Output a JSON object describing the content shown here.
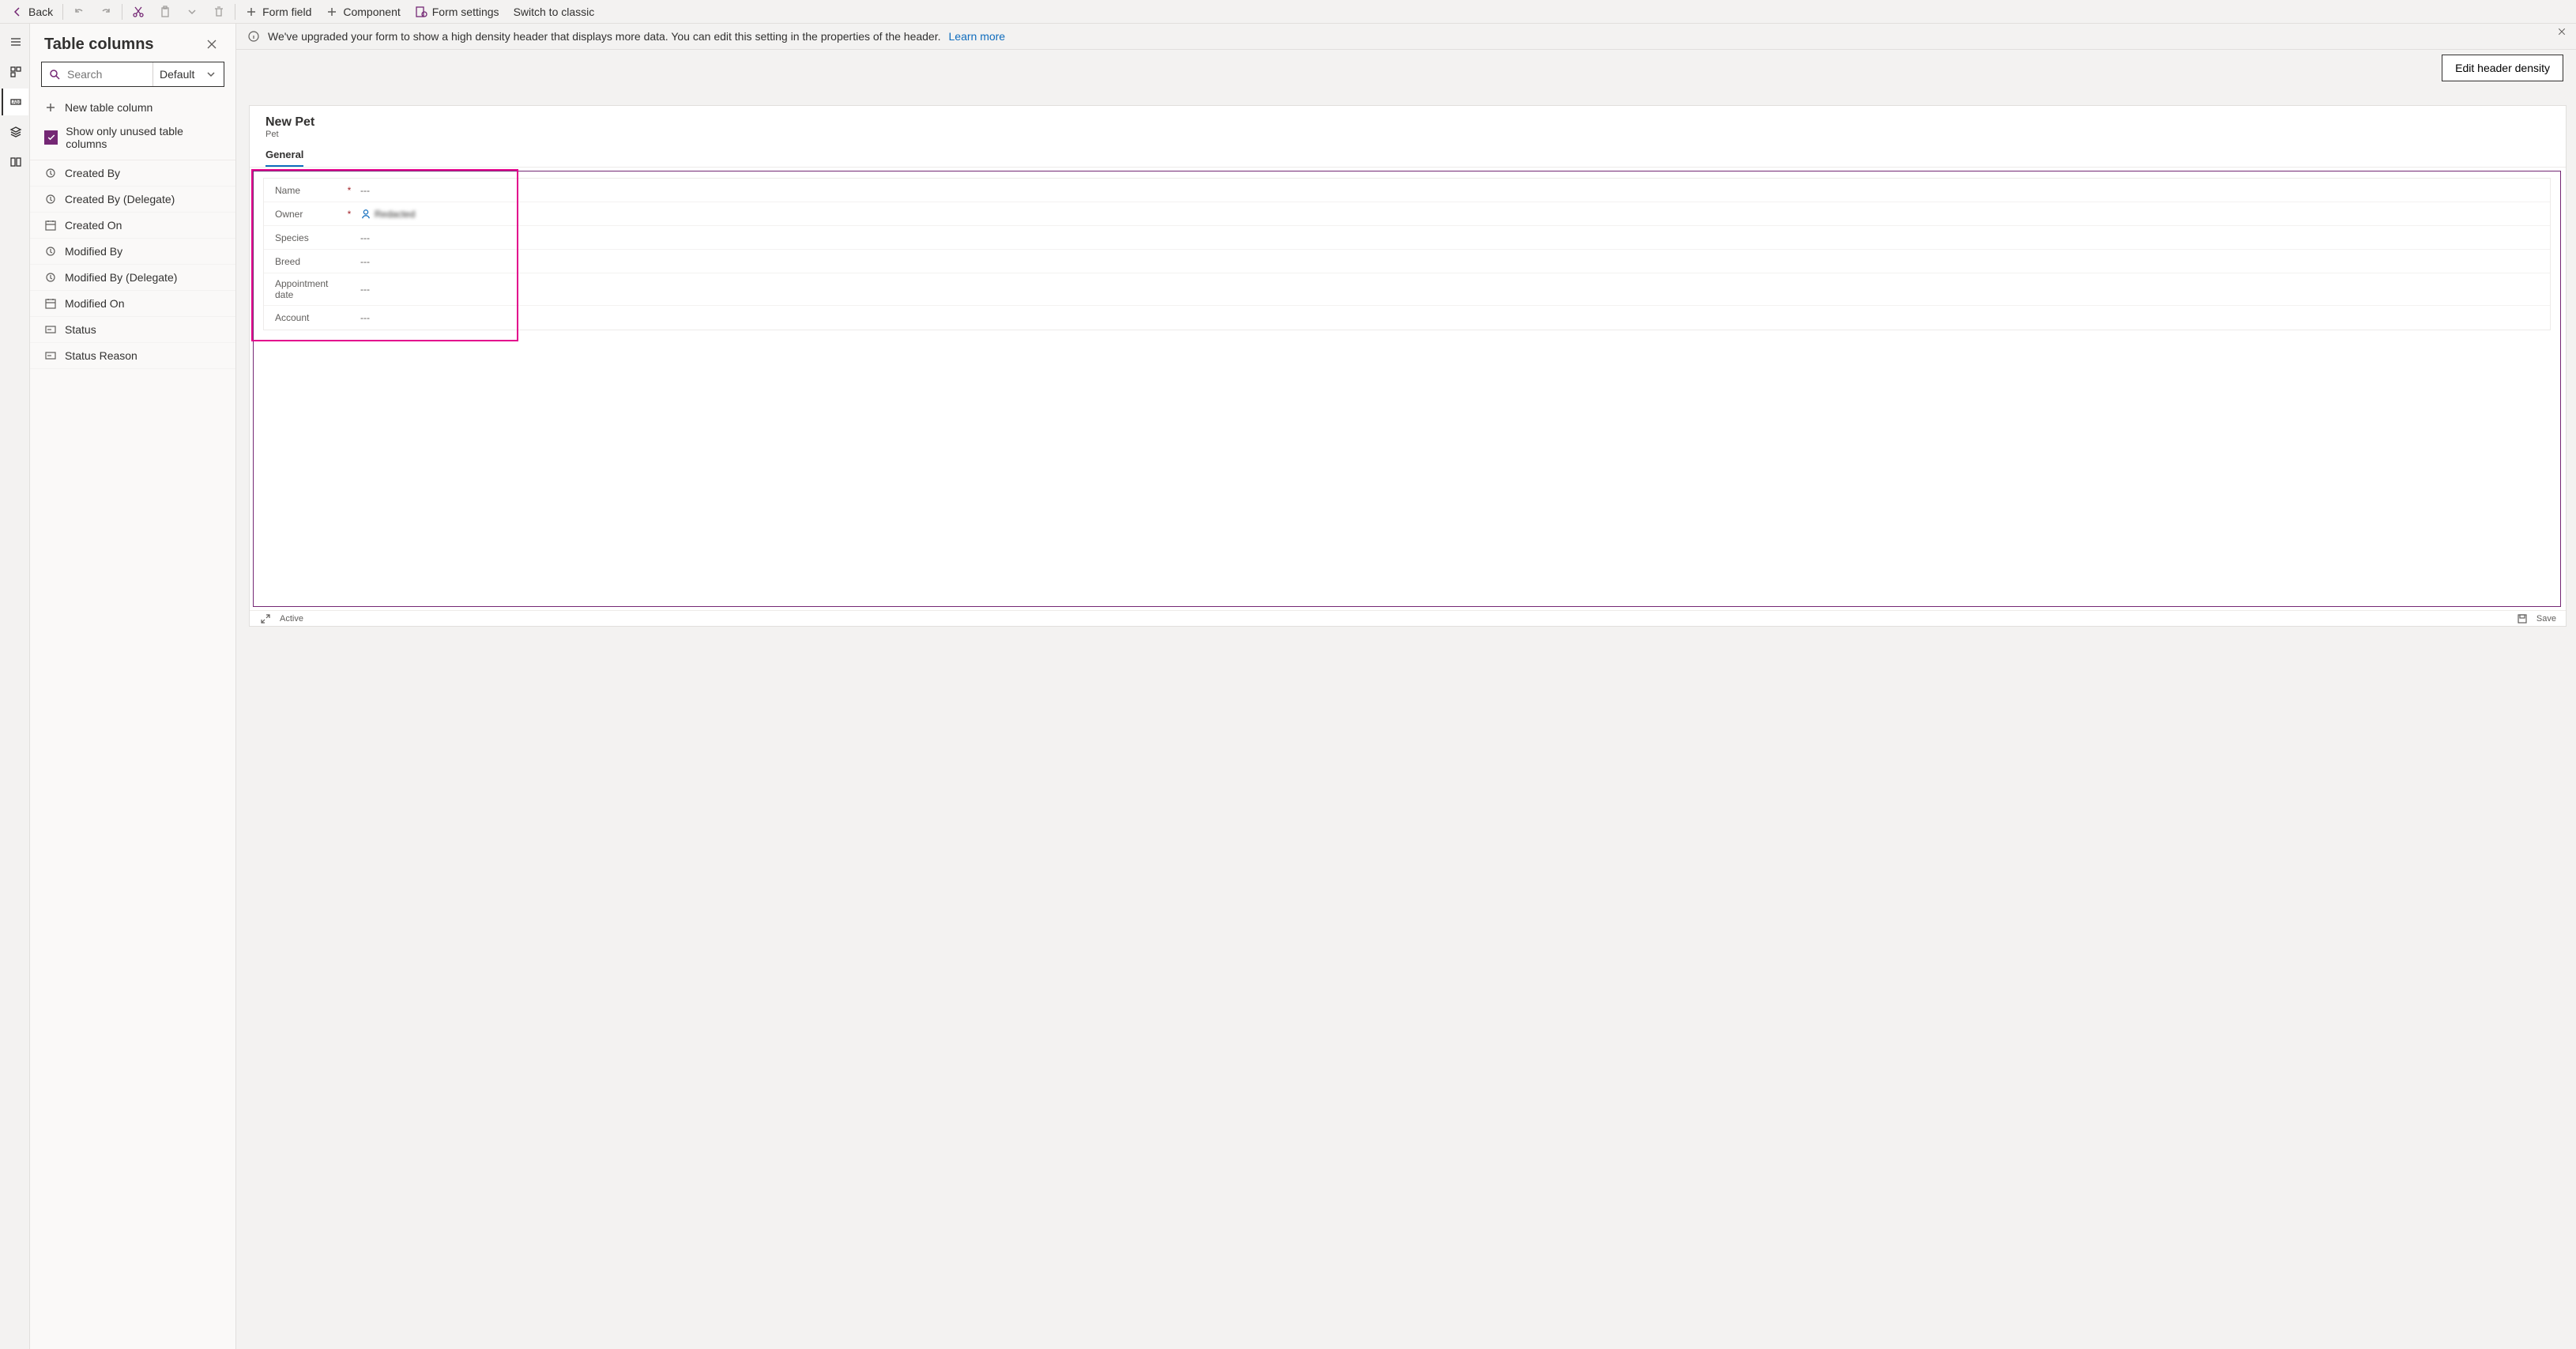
{
  "toolbar": {
    "back": "Back",
    "formField": "Form field",
    "component": "Component",
    "formSettings": "Form settings",
    "switchClassic": "Switch to classic"
  },
  "panel": {
    "title": "Table columns",
    "searchPlaceholder": "Search",
    "filter": "Default",
    "newColumn": "New table column",
    "showUnused": "Show only unused table columns",
    "columns": [
      {
        "label": "Created By",
        "type": "lookup"
      },
      {
        "label": "Created By (Delegate)",
        "type": "lookup"
      },
      {
        "label": "Created On",
        "type": "datetime"
      },
      {
        "label": "Modified By",
        "type": "lookup"
      },
      {
        "label": "Modified By (Delegate)",
        "type": "lookup"
      },
      {
        "label": "Modified On",
        "type": "datetime"
      },
      {
        "label": "Status",
        "type": "choice"
      },
      {
        "label": "Status Reason",
        "type": "choice"
      }
    ]
  },
  "info": {
    "message": "We've upgraded your form to show a high density header that displays more data. You can edit this setting in the properties of the header.",
    "link": "Learn more",
    "button": "Edit header density"
  },
  "form": {
    "title": "New Pet",
    "entity": "Pet",
    "tab": "General",
    "fields": [
      {
        "label": "Name",
        "required": true,
        "value": "---"
      },
      {
        "label": "Owner",
        "required": true,
        "owner": true,
        "ownerName": "Redacted"
      },
      {
        "label": "Species",
        "required": false,
        "value": "---"
      },
      {
        "label": "Breed",
        "required": false,
        "value": "---"
      },
      {
        "label": "Appointment date",
        "required": false,
        "value": "---"
      },
      {
        "label": "Account",
        "required": false,
        "value": "---"
      }
    ],
    "status": "Active",
    "save": "Save"
  }
}
